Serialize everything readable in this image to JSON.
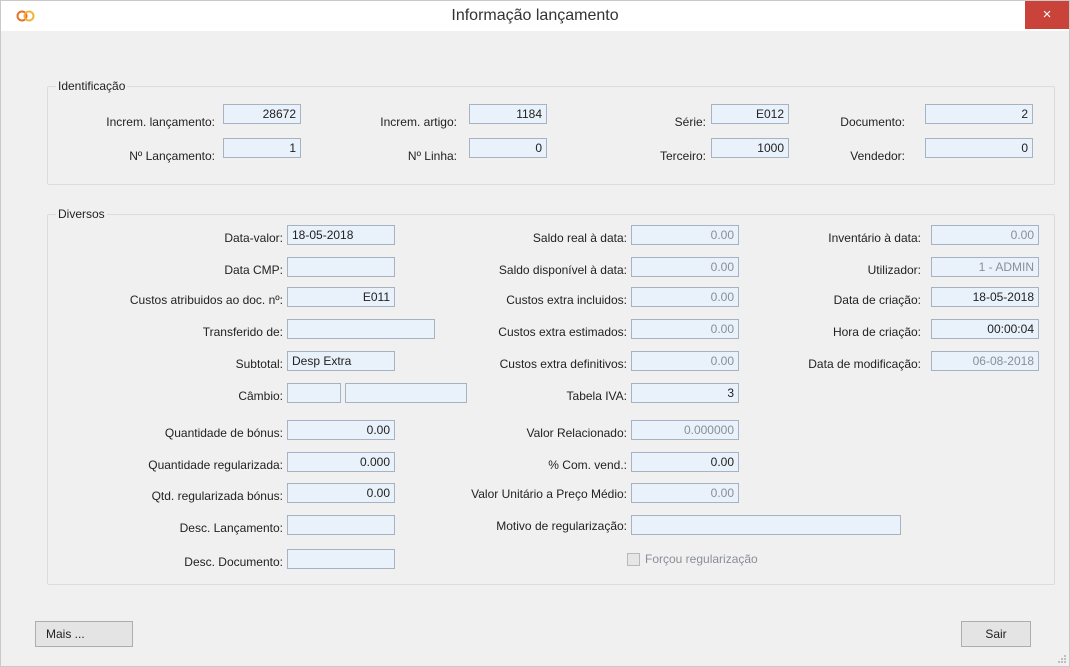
{
  "window": {
    "title": "Informação lançamento",
    "close_label": "×"
  },
  "identificacao": {
    "legend": "Identificação",
    "increm_lancamento": {
      "label": "Increm. lançamento:",
      "value": "28672"
    },
    "increm_artigo": {
      "label": "Increm. artigo:",
      "value": "1184"
    },
    "serie": {
      "label": "Série:",
      "value": "E012"
    },
    "documento": {
      "label": "Documento:",
      "value": "2"
    },
    "n_lancamento": {
      "label": "Nº Lançamento:",
      "value": "1"
    },
    "n_linha": {
      "label": "Nº Linha:",
      "value": "0"
    },
    "terceiro": {
      "label": "Terceiro:",
      "value": "1000"
    },
    "vendedor": {
      "label": "Vendedor:",
      "value": "0"
    }
  },
  "diversos": {
    "legend": "Diversos",
    "data_valor": {
      "label": "Data-valor:",
      "value": "18-05-2018"
    },
    "data_cmp": {
      "label": "Data CMP:",
      "value": ""
    },
    "custos_atribuidos": {
      "label": "Custos atribuidos ao doc. nº:",
      "value": "E011"
    },
    "transferido_de": {
      "label": "Transferido de:",
      "value": ""
    },
    "subtotal": {
      "label": "Subtotal:",
      "value": "Desp Extra"
    },
    "cambio": {
      "label": "Câmbio:",
      "value1": "",
      "value2": ""
    },
    "qtd_bonus": {
      "label": "Quantidade de bónus:",
      "value": "0.00"
    },
    "qtd_regularizada": {
      "label": "Quantidade regularizada:",
      "value": "0.000"
    },
    "qtd_reg_bonus": {
      "label": "Qtd. regularizada bónus:",
      "value": "0.00"
    },
    "desc_lancamento": {
      "label": "Desc. Lançamento:",
      "value": ""
    },
    "desc_documento": {
      "label": "Desc. Documento:",
      "value": ""
    },
    "saldo_real": {
      "label": "Saldo real à data:",
      "value": "0.00"
    },
    "saldo_disponivel": {
      "label": "Saldo disponível à data:",
      "value": "0.00"
    },
    "custos_incluidos": {
      "label": "Custos extra incluidos:",
      "value": "0.00"
    },
    "custos_estimados": {
      "label": "Custos extra estimados:",
      "value": "0.00"
    },
    "custos_definitivos": {
      "label": "Custos extra definitivos:",
      "value": "0.00"
    },
    "tabela_iva": {
      "label": "Tabela IVA:",
      "value": "3"
    },
    "valor_relacionado": {
      "label": "Valor Relacionado:",
      "value": "0.000000"
    },
    "com_vend": {
      "label": "% Com. vend.:",
      "value": "0.00"
    },
    "valor_unitario": {
      "label": "Valor Unitário a Preço Médio:",
      "value": "0.00"
    },
    "motivo_regularizacao": {
      "label": "Motivo de regularização:",
      "value": ""
    },
    "forcou_regularizacao": {
      "label": "Forçou regularização",
      "checked": false
    },
    "inventario": {
      "label": "Inventário à data:",
      "value": "0.00"
    },
    "utilizador": {
      "label": "Utilizador:",
      "value": "1 - ADMIN"
    },
    "data_criacao": {
      "label": "Data de criação:",
      "value": "18-05-2018"
    },
    "hora_criacao": {
      "label": "Hora de criação:",
      "value": "00:00:04"
    },
    "data_modificacao": {
      "label": "Data de modificação:",
      "value": "06-08-2018"
    }
  },
  "buttons": {
    "mais": "Mais ...",
    "sair": "Sair"
  }
}
